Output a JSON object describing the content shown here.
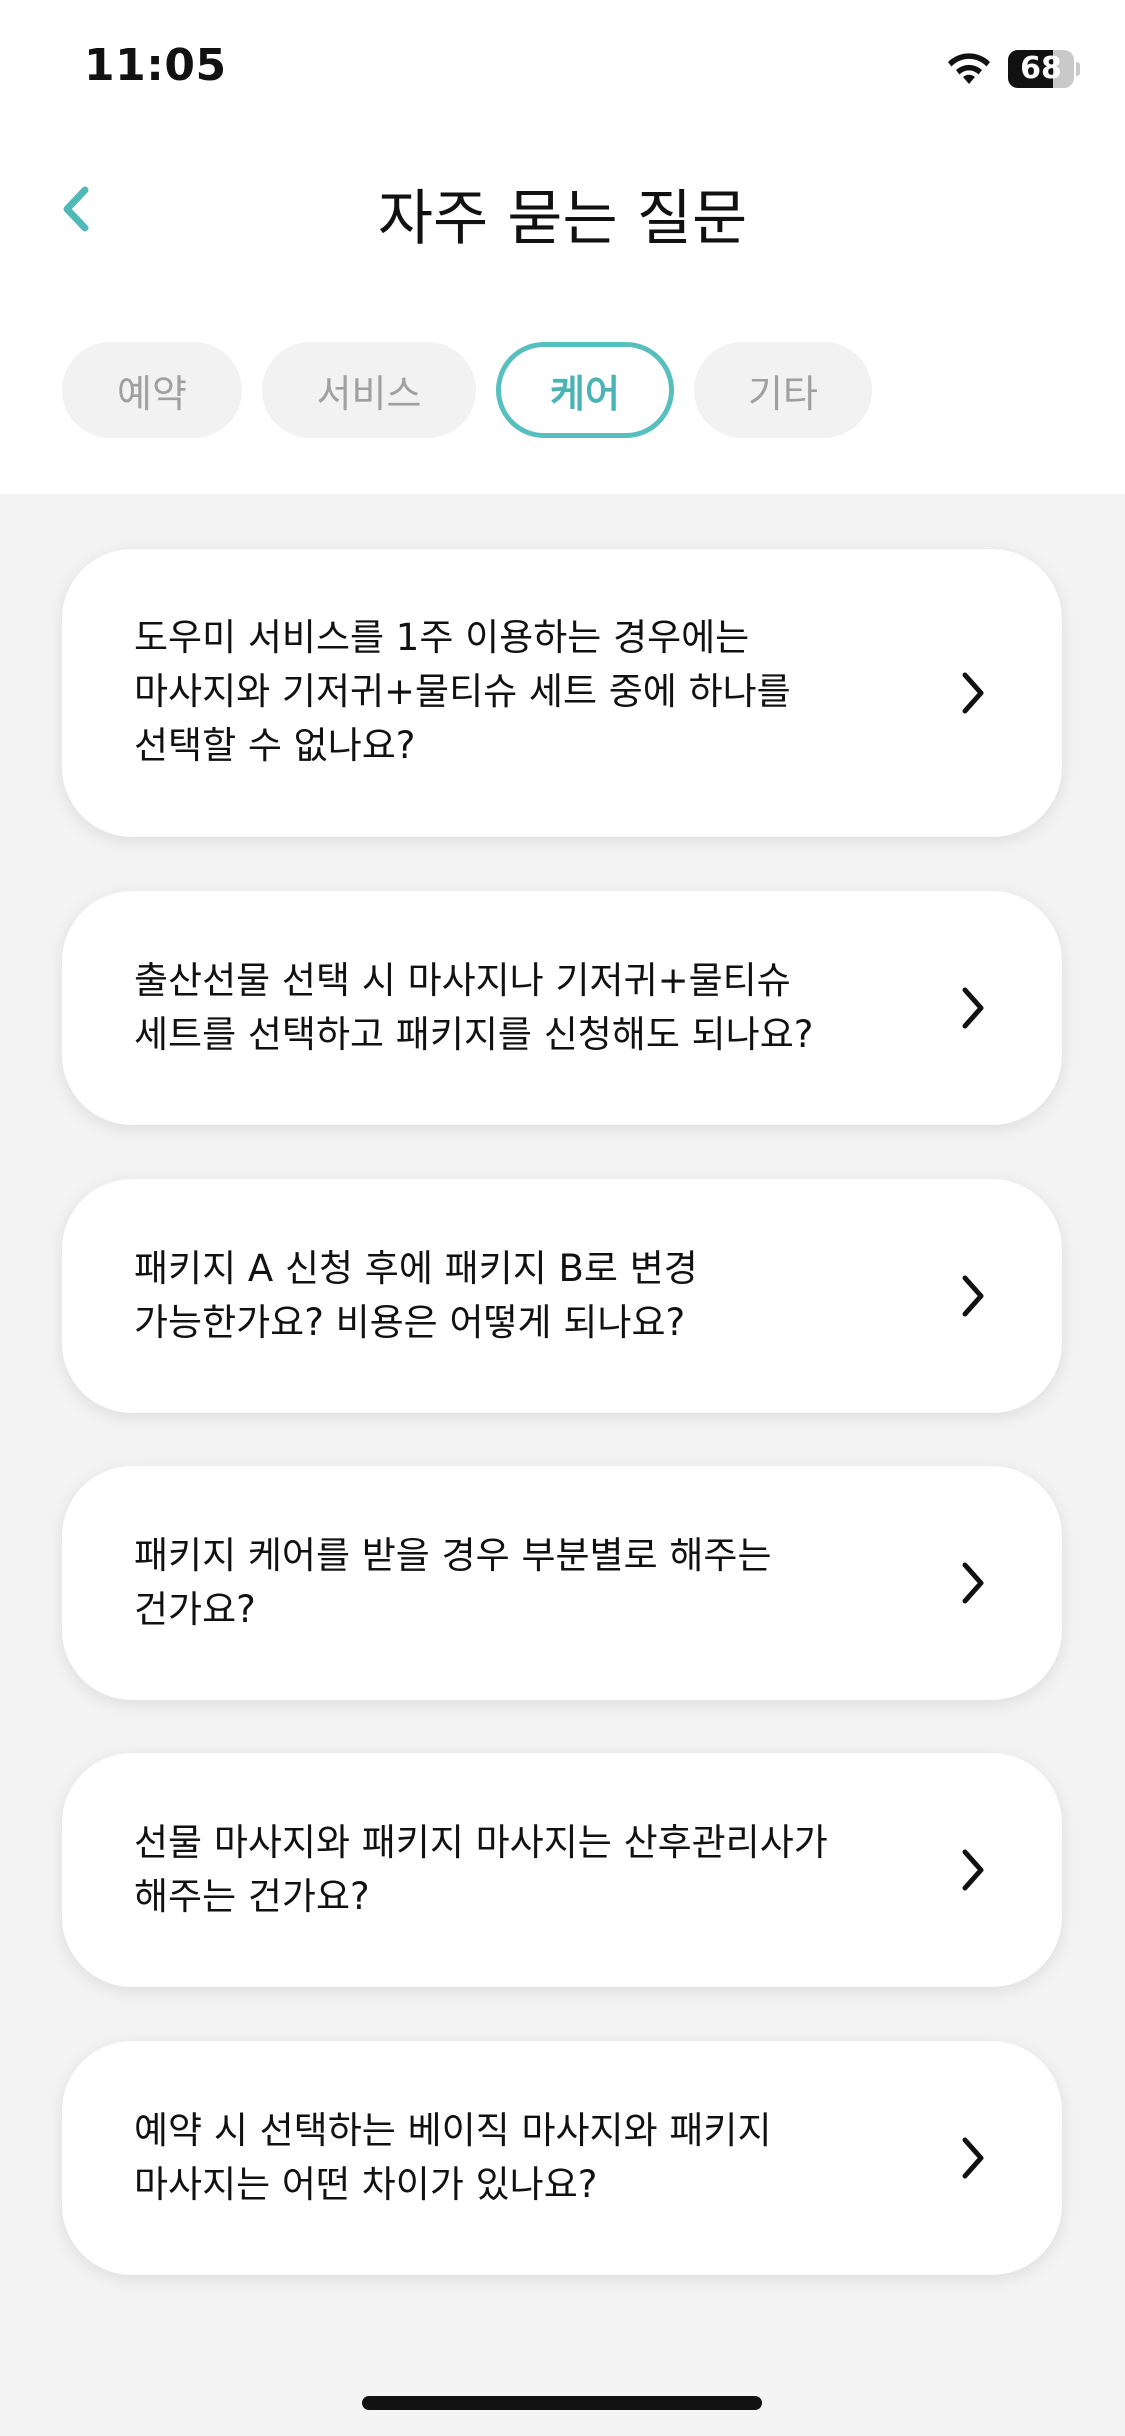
{
  "status_bar": {
    "time": "11:05",
    "battery_level": "68",
    "battery_fraction": 0.68
  },
  "header": {
    "title": "자주 묻는 질문",
    "back_icon": "chevron-left-icon"
  },
  "tabs": [
    {
      "label": "예약",
      "active": false
    },
    {
      "label": "서비스",
      "active": false
    },
    {
      "label": "케어",
      "active": true
    },
    {
      "label": "기타",
      "active": false
    }
  ],
  "faq_items": [
    {
      "question": "도우미 서비스를 1주 이용하는 경우에는\n마사지와 기저귀+물티슈 세트 중에 하나를\n선택할 수 없나요?"
    },
    {
      "question": "출산선물 선택 시 마사지나 기저귀+물티슈\n세트를 선택하고 패키지를 신청해도 되나요?"
    },
    {
      "question": "패키지 A 신청 후에 패키지 B로 변경\n가능한가요? 비용은 어떻게 되나요?"
    },
    {
      "question": "패키지 케어를 받을 경우 부분별로 해주는\n건가요?"
    },
    {
      "question": "선물 마사지와 패키지 마사지는 산후관리사가\n해주는 건가요?"
    },
    {
      "question": "예약 시 선택하는 베이직 마사지와 패키지\n마사지는 어떤 차이가 있나요?"
    }
  ],
  "colors": {
    "accent": "#58bfbf",
    "background": "#f4f4f4",
    "card": "#ffffff",
    "inactive_tab": "#f2f2f2"
  }
}
